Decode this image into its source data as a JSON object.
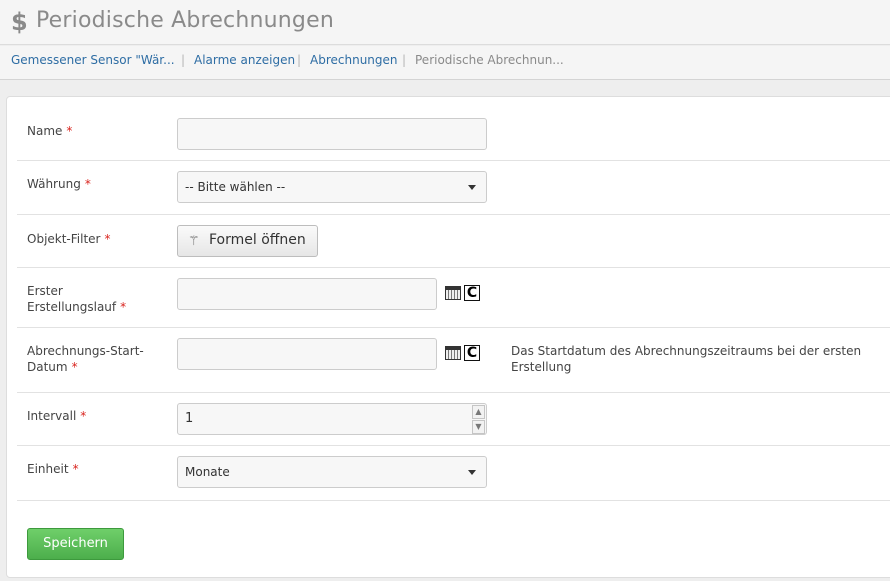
{
  "header": {
    "icon": "dollar-icon",
    "title": "Periodische Abrechnungen"
  },
  "breadcrumb": {
    "items": [
      "Gemessener Sensor \"Wär...",
      "Alarme anzeigen",
      "Abrechnungen"
    ],
    "current": "Periodische Abrechnun...",
    "separator": "|"
  },
  "form": {
    "required_marker": "*",
    "name": {
      "label": "Name",
      "value": ""
    },
    "currency": {
      "label": "Währung",
      "selected": "-- Bitte wählen --"
    },
    "filter": {
      "label": "Objekt-Filter",
      "button_label": "Formel öffnen",
      "button_icon": "wand-icon"
    },
    "first_run": {
      "label_line1": "Erster",
      "label_line2": "Erstellungslauf",
      "value": ""
    },
    "start_date": {
      "label_line1": "Abrechnungs-Start-",
      "label_line2": "Datum",
      "value": "",
      "help_line1": "Das Startdatum des Abrechnungszeitraums bei der ersten",
      "help_line2": "Erstellung"
    },
    "interval": {
      "label": "Intervall",
      "value": "1"
    },
    "unit": {
      "label": "Einheit",
      "selected": "Monate"
    },
    "save_label": "Speichern"
  },
  "icons": {
    "calendar": "calendar-icon",
    "clear": "clear-icon",
    "clear_glyph": "C"
  }
}
